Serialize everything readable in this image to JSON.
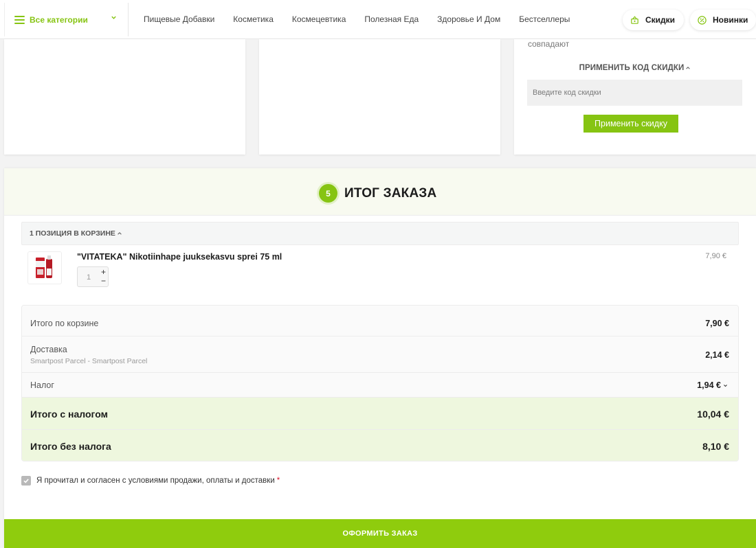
{
  "nav": {
    "categories_label": "Все категории",
    "links": [
      "Пищевые Добавки",
      "Косметика",
      "Космецевтика",
      "Полезная Еда",
      "Здоровье И Дом",
      "Бестселлеры"
    ],
    "sale_label": "Скидки",
    "new_label": "Новинки"
  },
  "coupon": {
    "notice_fragment": "совпадают",
    "title": "ПРИМЕНИТЬ КОД СКИДКИ",
    "placeholder": "Введите код скидки",
    "apply_label": "Применить скидку"
  },
  "summary": {
    "step": "5",
    "title": "ИТОГ ЗАКАЗА",
    "cart_count_label": "1 ПОЗИЦИЯ В КОРЗИНЕ",
    "product": {
      "name": "\"VITATEKA\" Nikotiinhape juuksekasvu sprei 75 ml",
      "price": "7,90 €",
      "quantity": "1"
    },
    "totals": {
      "subtotal_label": "Итого по корзине",
      "subtotal_value": "7,90 €",
      "shipping_label": "Доставка",
      "shipping_method": "Smartpost Parcel - Smartpost Parcel",
      "shipping_value": "2,14 €",
      "tax_label": "Налог",
      "tax_value": "1,94 €",
      "total_incl_label": "Итого с налогом",
      "total_incl_value": "10,04 €",
      "total_excl_label": "Итого без налога",
      "total_excl_value": "8,10 €"
    },
    "terms_label": "Я прочитал и согласен с условиями продажи, оплаты и доставки",
    "terms_required_mark": "*",
    "terms_checked": true,
    "checkout_label": "ОФОРМИТЬ ЗАКАЗ"
  },
  "colors": {
    "accent": "#86c412",
    "checkout": "#8fcc0d",
    "total_row_bg": "#eef7de",
    "required": "#d8152b"
  }
}
